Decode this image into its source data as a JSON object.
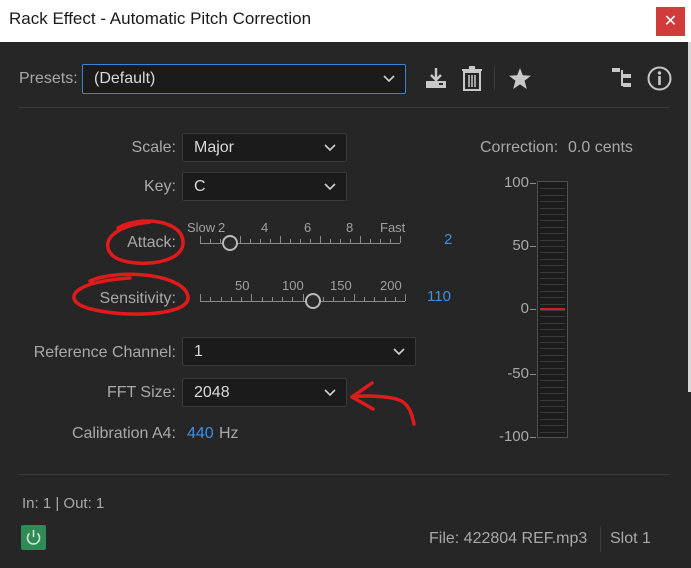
{
  "window": {
    "title": "Rack Effect - Automatic Pitch Correction",
    "close_glyph": "✕"
  },
  "presets": {
    "label": "Presets:",
    "value": "(Default)"
  },
  "toolbar": {
    "download_icon": "download-icon",
    "trash_icon": "trash-icon",
    "star_icon": "star-icon",
    "routing_icon": "routing-icon",
    "info_icon": "info-icon"
  },
  "scale": {
    "label": "Scale:",
    "value": "Major"
  },
  "key": {
    "label": "Key:",
    "value": "C"
  },
  "attack": {
    "label": "Attack:",
    "value": "2",
    "ticks": [
      "Slow",
      "2",
      "4",
      "6",
      "8",
      "Fast"
    ],
    "level": 0.125
  },
  "sensitivity": {
    "label": "Sensitivity:",
    "value": "110",
    "ticks": [
      "50",
      "100",
      "150",
      "200"
    ],
    "level": 0.55
  },
  "reference_channel": {
    "label": "Reference Channel:",
    "value": "1"
  },
  "fft_size": {
    "label": "FFT Size:",
    "value": "2048"
  },
  "calibration": {
    "label": "Calibration A4:",
    "value": "440",
    "unit": "Hz"
  },
  "correction": {
    "label": "Correction:",
    "value": "0.0 cents",
    "scale": [
      "100",
      "50",
      "0",
      "-50",
      "-100"
    ]
  },
  "io": {
    "text": "In: 1 | Out: 1"
  },
  "footer": {
    "file": "File: 422804 REF.mp3",
    "slot": "Slot 1"
  },
  "colors": {
    "accent_blue": "#3f8fe6",
    "annotation_red": "#e01b1b",
    "power_green": "#2f8a55"
  }
}
